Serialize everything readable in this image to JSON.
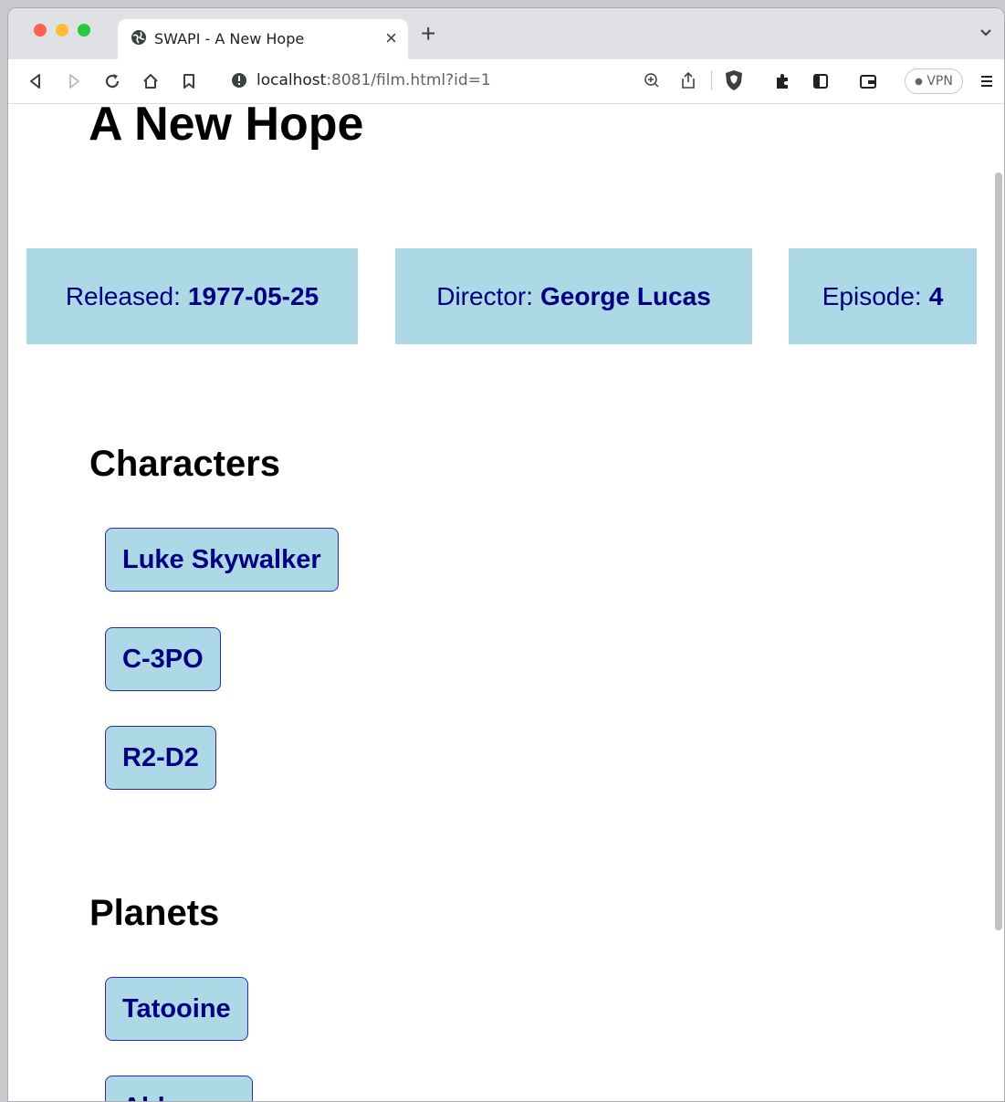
{
  "browser": {
    "tab_title": "SWAPI - A New Hope",
    "tab_close": "×",
    "new_tab": "+",
    "url_host": "localhost",
    "url_rest": ":8081/film.html?id=1",
    "vpn_label": "VPN"
  },
  "film": {
    "title": "A New Hope",
    "released_label": "Released:",
    "released_value": "1977-05-25",
    "director_label": "Director:",
    "director_value": "George Lucas",
    "episode_label": "Episode:",
    "episode_value": "4"
  },
  "characters": {
    "heading": "Characters",
    "items": [
      "Luke Skywalker",
      "C-3PO",
      "R2-D2"
    ]
  },
  "planets": {
    "heading": "Planets",
    "items": [
      "Tatooine",
      "Alderaan"
    ]
  },
  "colors": {
    "box_bg": "#add8e6",
    "box_text": "#000080"
  }
}
